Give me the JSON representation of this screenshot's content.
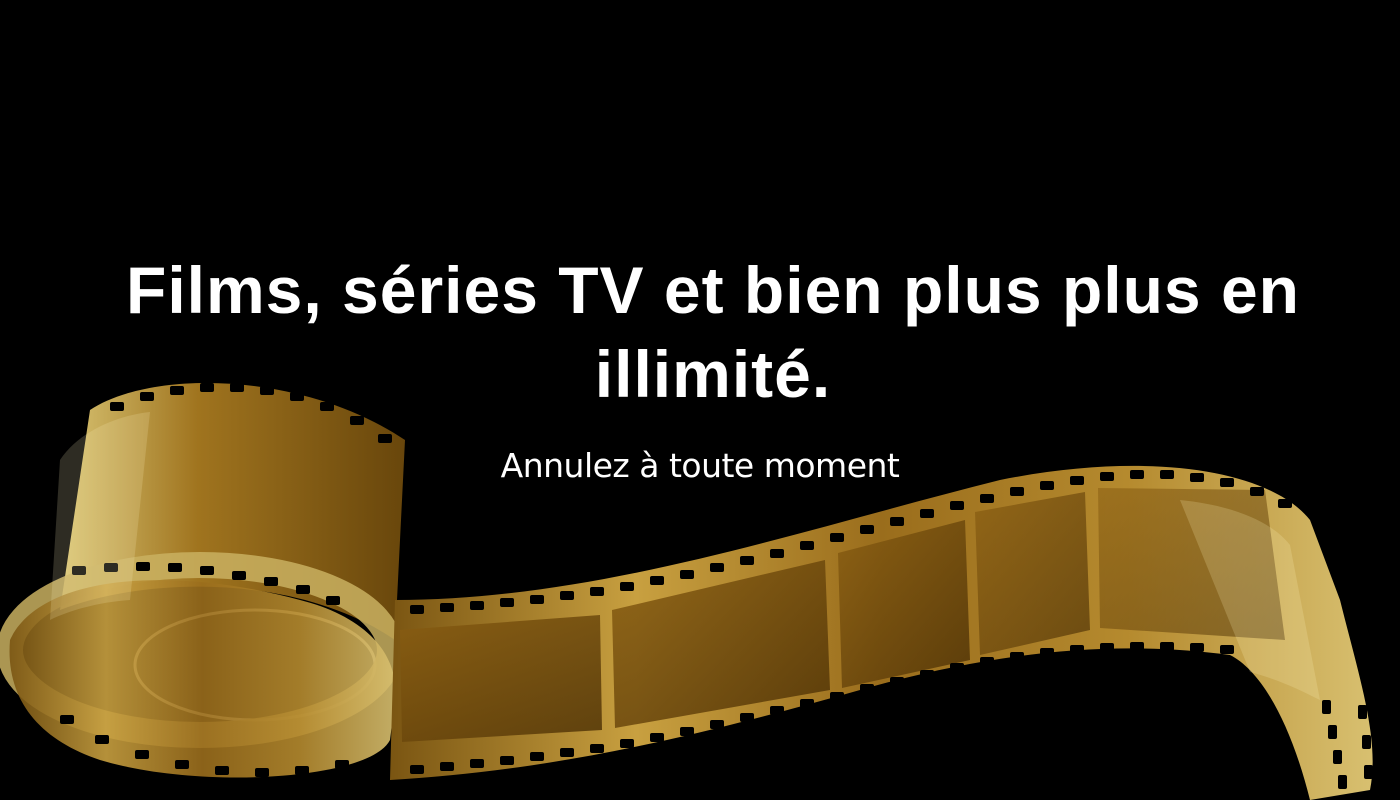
{
  "hero": {
    "headline": "Films, séries TV et bien plus plus en illimité.",
    "subline": "Annulez à toute moment"
  },
  "art": {
    "icon": "film-strip-icon",
    "colors": {
      "background": "#000000",
      "gold_light": "#e8d27a",
      "gold_mid": "#b8892a",
      "gold_dark": "#5a3c08",
      "text": "#ffffff"
    }
  }
}
